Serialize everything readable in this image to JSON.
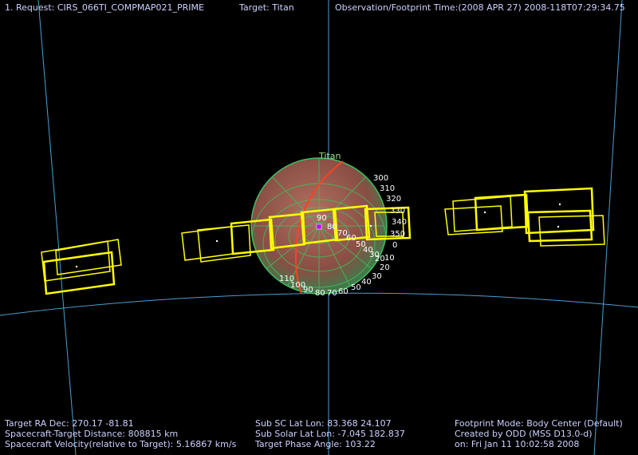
{
  "header": {
    "request": "1. Request: CIRS_066TI_COMPMAP021_PRIME",
    "target": "Target: Titan",
    "observation_time": "Observation/Footprint Time:(2008 APR 27) 2008-118T07:29:34.75"
  },
  "scene": {
    "body_label": "Titan",
    "longitude_labels_right": [
      "300",
      "310",
      "320",
      "330",
      "340",
      "350",
      "0",
      "10",
      "20",
      "30",
      "40",
      "50",
      "60",
      "70",
      "80",
      "90",
      "100",
      "110"
    ],
    "latitude_labels_center": [
      "90",
      "80",
      "70",
      "60",
      "50",
      "40",
      "30",
      "20"
    ],
    "colors": {
      "grid_lines": "#4a9fd0",
      "footprints": "#ffff00",
      "planet_fill": "#a06050",
      "planet_grid": "#3fbf5f",
      "terminator": "#ff4020",
      "sub_sc_marker": "#c000ff"
    }
  },
  "footer": {
    "left": [
      "Target RA Dec: 270.17   -81.81",
      "Spacecraft-Target Distance:  808815 km",
      "Spacecraft Velocity(relative to Target): 5.16867 km/s"
    ],
    "middle": [
      "Sub SC Lat Lon: 83.368  24.107",
      "Sub Solar Lat Lon: -7.045  182.837",
      "Target Phase Angle: 103.22"
    ],
    "right": [
      "Footprint Mode: Body Center (Default)",
      "Created by ODD (MSS D13.0-d)",
      "on: Fri Jan 11 10:02:58 2008"
    ]
  }
}
